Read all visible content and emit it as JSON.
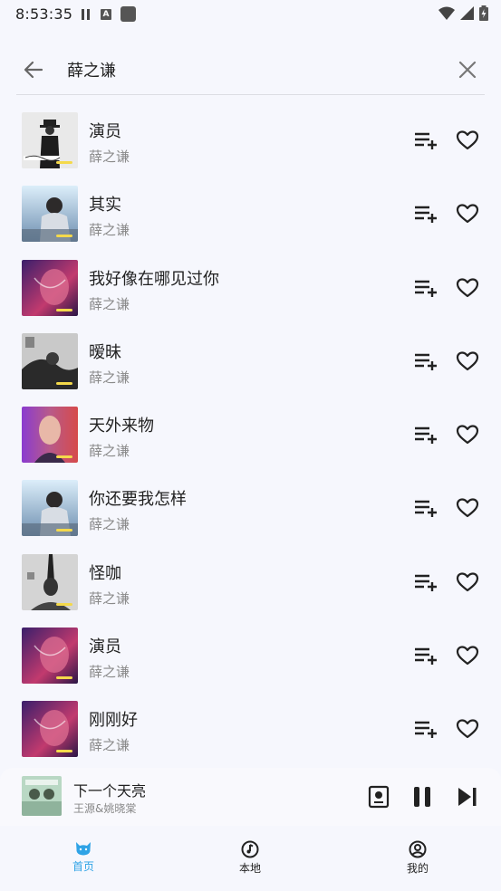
{
  "status_bar": {
    "time": "8:53:35",
    "a_badge": "A"
  },
  "search": {
    "query": "薛之谦"
  },
  "songs": [
    {
      "title": "演员",
      "artist": "薛之谦"
    },
    {
      "title": "其实",
      "artist": "薛之谦"
    },
    {
      "title": "我好像在哪见过你",
      "artist": "薛之谦"
    },
    {
      "title": "暧昧",
      "artist": "薛之谦"
    },
    {
      "title": "天外来物",
      "artist": "薛之谦"
    },
    {
      "title": "你还要我怎样",
      "artist": "薛之谦"
    },
    {
      "title": "怪咖",
      "artist": "薛之谦"
    },
    {
      "title": "演员",
      "artist": "薛之谦"
    },
    {
      "title": "刚刚好",
      "artist": "薛之谦"
    }
  ],
  "now_playing": {
    "title": "下一个天亮",
    "artist": "王源&姚晓棠"
  },
  "nav": {
    "home": "首页",
    "local": "本地",
    "mine": "我的"
  },
  "colors": {
    "accent": "#2fa3e6",
    "background": "#f6f7fd"
  }
}
